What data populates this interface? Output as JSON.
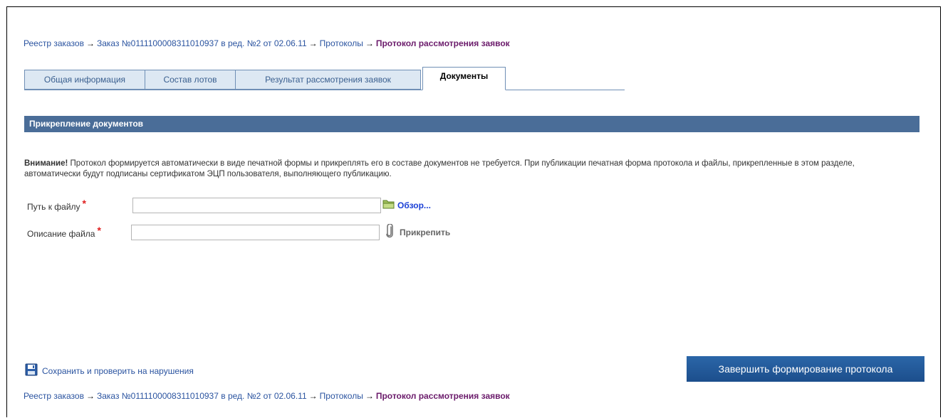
{
  "breadcrumb": {
    "registry": "Реестр заказов",
    "order": "Заказ №0111100008311010937 в ред. №2 от 02.06.11",
    "protocols": "Протоколы",
    "current": "Протокол рассмотрения заявок",
    "separator": "→"
  },
  "tabs": [
    {
      "label": "Общая информация",
      "active": false
    },
    {
      "label": "Состав лотов",
      "active": false
    },
    {
      "label": "Результат рассмотрения заявок",
      "active": false
    },
    {
      "label": "Документы",
      "active": true
    }
  ],
  "section": {
    "title": "Прикрепление документов"
  },
  "notice": {
    "strong": "Внимание!",
    "text": "Протокол формируется автоматически в виде печатной формы и прикреплять его в составе документов не требуется. При публикации печатная форма протокола и файлы, прикрепленные в этом разделе, автоматически будут подписаны сертификатом ЭЦП пользователя, выполняющего публикацию."
  },
  "form": {
    "file_path_label": "Путь к файлу",
    "file_path_value": "",
    "file_description_label": "Описание файла",
    "file_description_value": "",
    "required_mark": "*",
    "browse_label": "Обзор...",
    "attach_label": "Прикрепить"
  },
  "actions": {
    "save_label": "Сохранить и проверить на нарушения",
    "finish_label": "Завершить формирование протокола"
  },
  "icons": {
    "browse": "folder-icon",
    "attach": "paperclip-icon",
    "save": "floppy-disk-icon"
  },
  "colors": {
    "link": "#2b54a0",
    "current_crumb": "#6b1b6b",
    "section_header_bg": "#4a6d98",
    "button_bg": "#1c4e8c",
    "required": "#e02020",
    "browse_link": "#1a3fd6"
  }
}
